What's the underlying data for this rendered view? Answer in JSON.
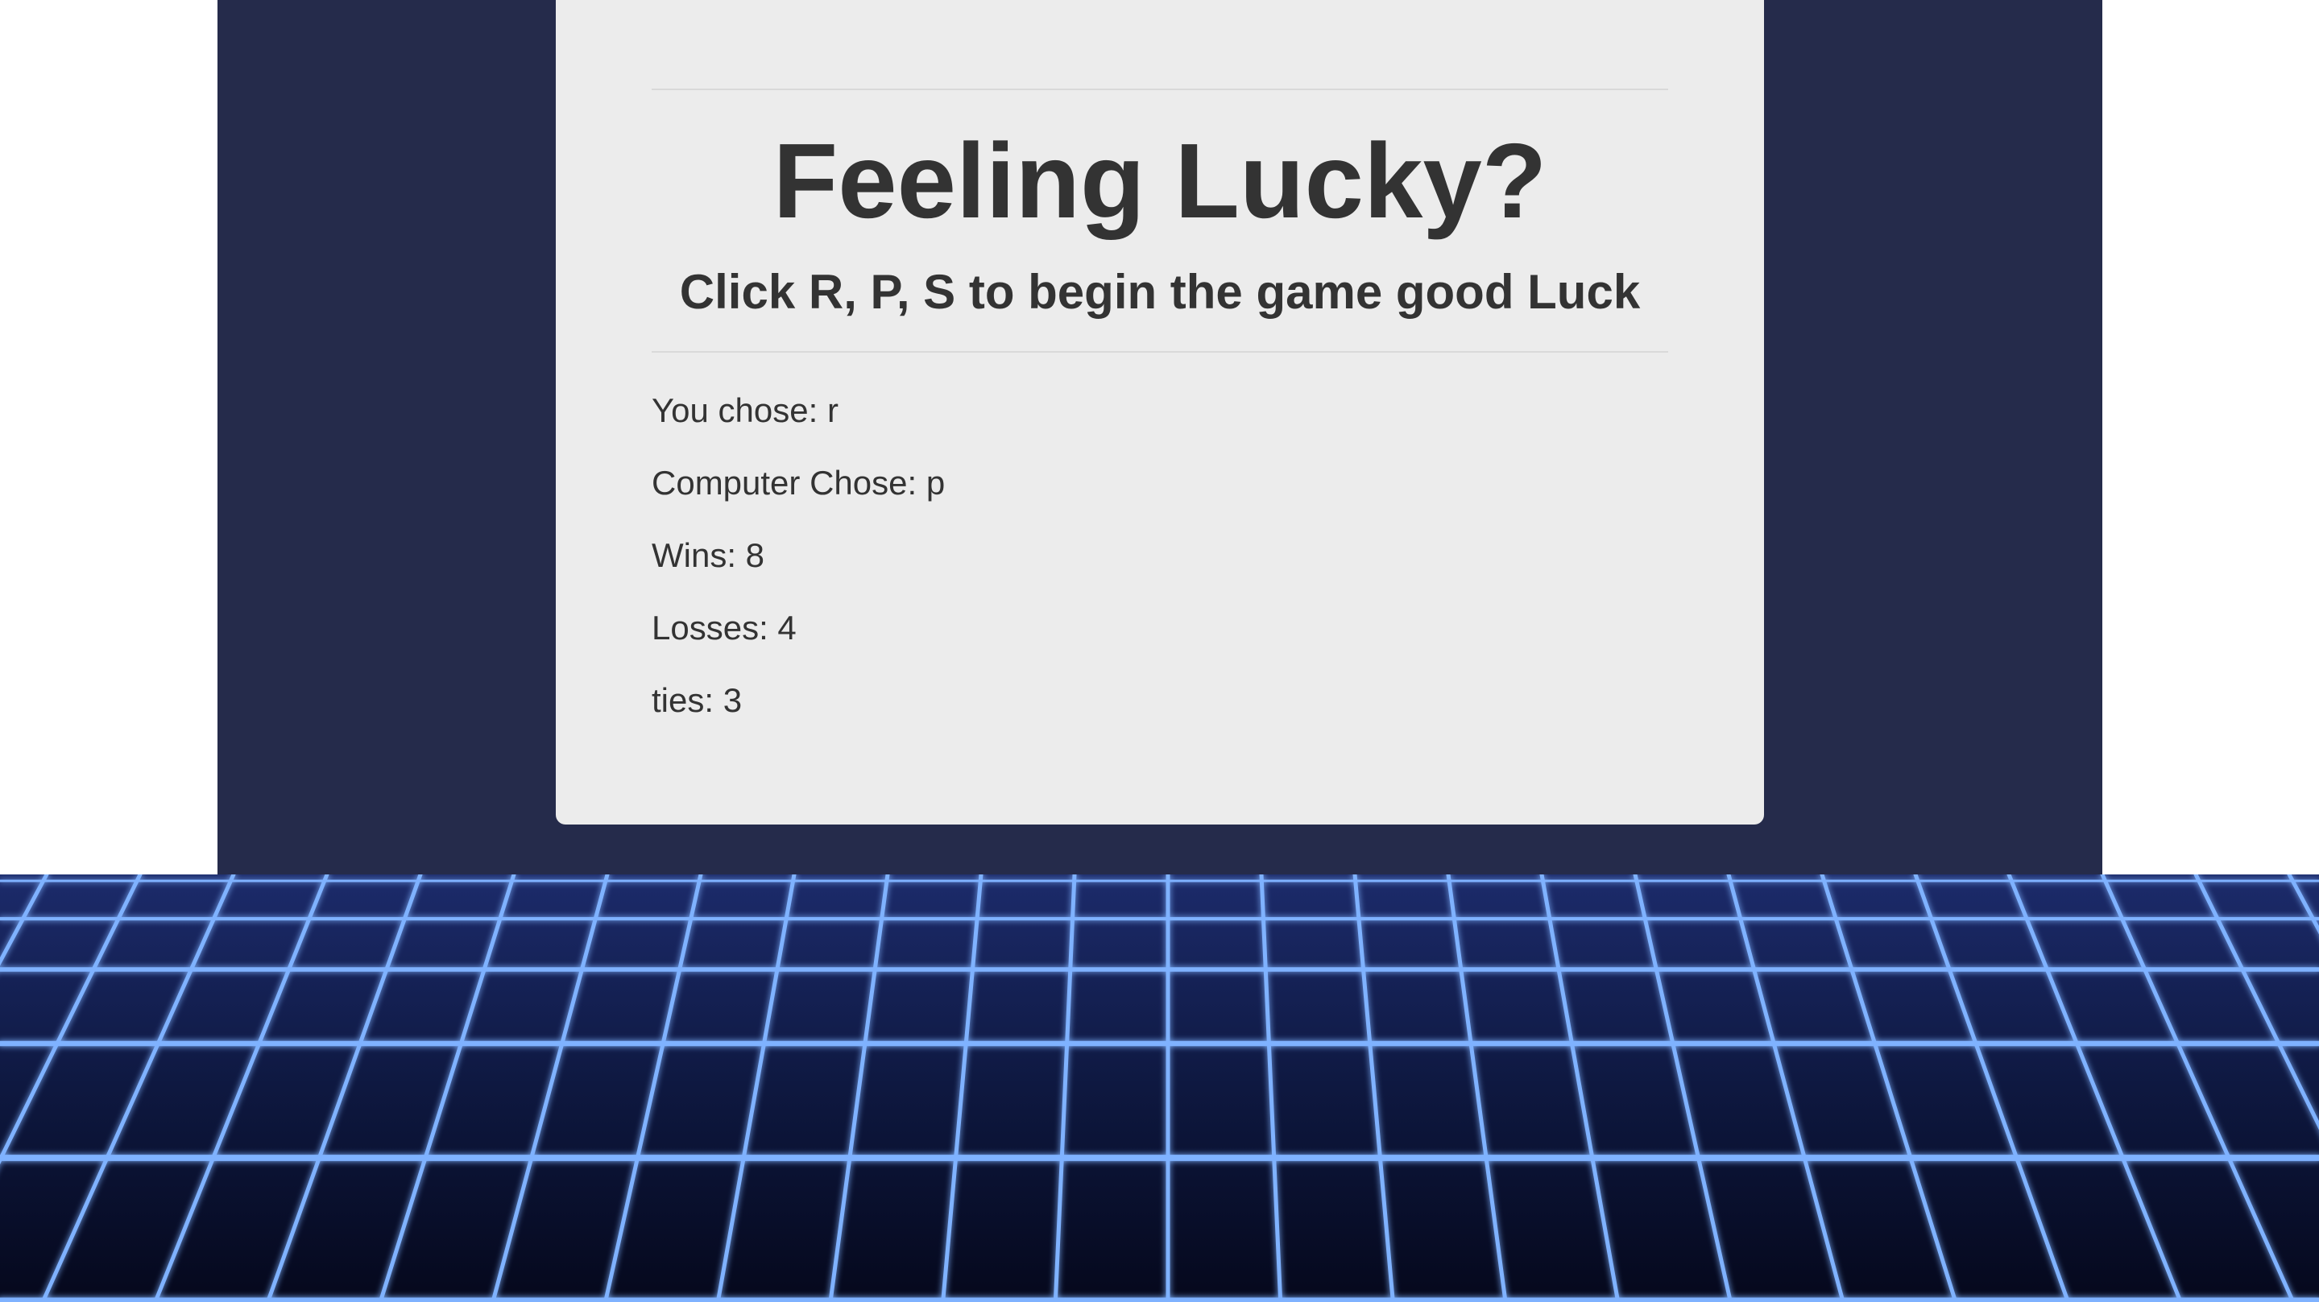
{
  "colors": {
    "backdrop": "#252b4b",
    "card": "#ececec",
    "text": "#333333",
    "grid_line": "#7fb2ff",
    "floor": "#0b1335"
  },
  "header": {
    "title": "Feeling Lucky?",
    "subtitle": "Click R, P, S to begin the game good Luck"
  },
  "results": {
    "you_chose": "You chose: r",
    "computer_chose": "Computer Chose: p",
    "wins": "Wins: 8",
    "losses": "Losses: 4",
    "ties": "ties: 3"
  },
  "decor": {
    "background": "neon-grid-floor"
  }
}
